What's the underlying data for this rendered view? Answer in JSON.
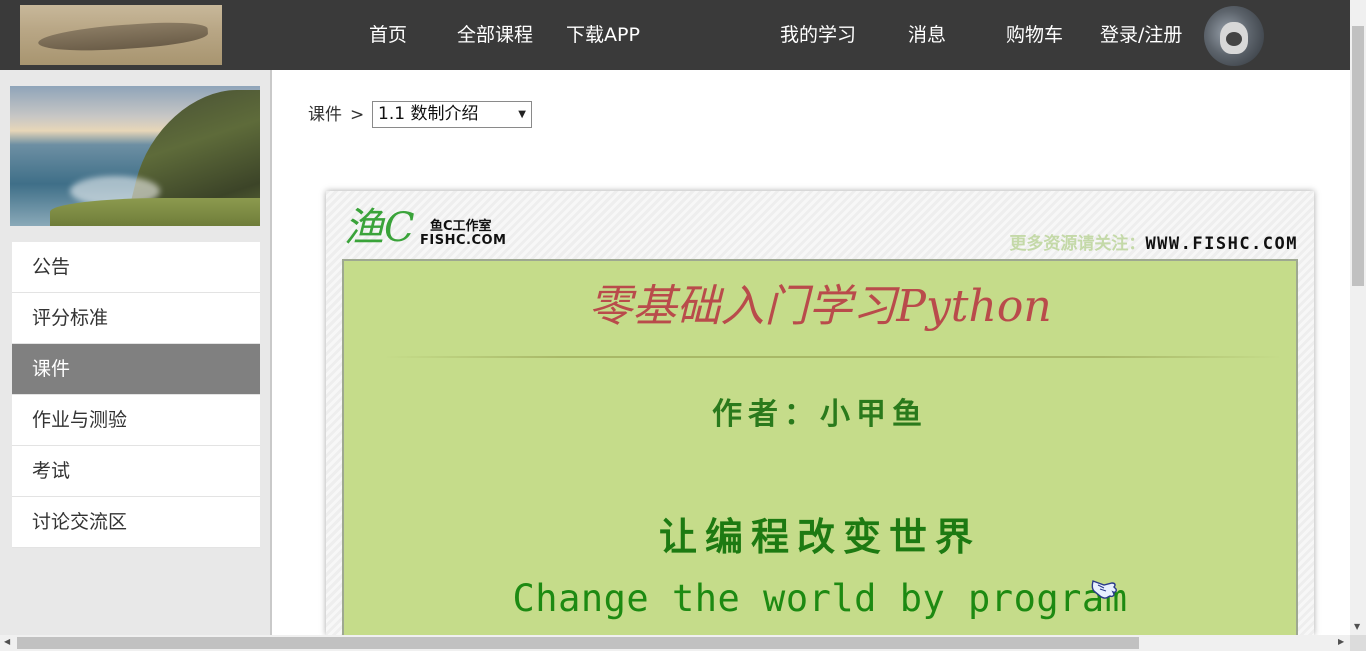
{
  "header": {
    "nav": {
      "home": "首页",
      "all_courses": "全部课程",
      "download_app": "下载APP",
      "my_learning": "我的学习",
      "messages": "消息",
      "cart": "购物车",
      "login_register": "登录/注册"
    }
  },
  "sidebar": {
    "items": [
      {
        "label": "公告"
      },
      {
        "label": "评分标准"
      },
      {
        "label": "课件",
        "active": true
      },
      {
        "label": "作业与测验"
      },
      {
        "label": "考试"
      },
      {
        "label": "讨论交流区"
      }
    ]
  },
  "main": {
    "breadcrumb": {
      "label": "课件",
      "separator": ">"
    },
    "lesson_select": {
      "value": "1.1 数制介绍"
    },
    "slide": {
      "logo_cn": "鱼C工作室",
      "logo_en": "FISHC.COM",
      "site_prefix": "更多资源请关注：",
      "site_url": "WWW.FISHC.COM",
      "title": "零基础入门学习Python",
      "author": "作者：小甲鱼",
      "slogan": "让编程改变世界",
      "slogan_en": "Change the world by program"
    }
  },
  "colors": {
    "topbar": "#3a3a3a",
    "active_menu": "#808080",
    "slide_panel": "#c5dc8a",
    "slide_title": "#b94b4b",
    "slide_green": "#1d7a12"
  }
}
